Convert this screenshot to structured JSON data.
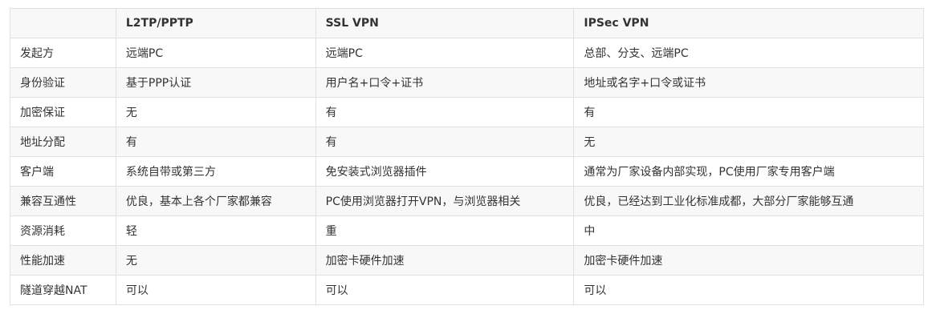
{
  "headers": [
    "",
    "L2TP/PPTP",
    "SSL VPN",
    "IPSec VPN"
  ],
  "rows": [
    [
      "发起方",
      "远端PC",
      "远端PC",
      "总部、分支、远端PC"
    ],
    [
      "身份验证",
      "基于PPP认证",
      "用户名+口令+证书",
      "地址或名字+口令或证书"
    ],
    [
      "加密保证",
      "无",
      "有",
      "有"
    ],
    [
      "地址分配",
      "有",
      "有",
      "无"
    ],
    [
      "客户端",
      "系统自带或第三方",
      "免安装式浏览器插件",
      "通常为厂家设备内部实现，PC使用厂家专用客户端"
    ],
    [
      "兼容互通性",
      "优良，基本上各个厂家都兼容",
      "PC使用浏览器打开VPN，与浏览器相关",
      "优良，已经达到工业化标准成都，大部分厂家能够互通"
    ],
    [
      "资源消耗",
      "轻",
      "重",
      "中"
    ],
    [
      "性能加速",
      "无",
      "加密卡硬件加速",
      "加密卡硬件加速"
    ],
    [
      "隧道穿越NAT",
      "可以",
      "可以",
      "可以"
    ]
  ]
}
